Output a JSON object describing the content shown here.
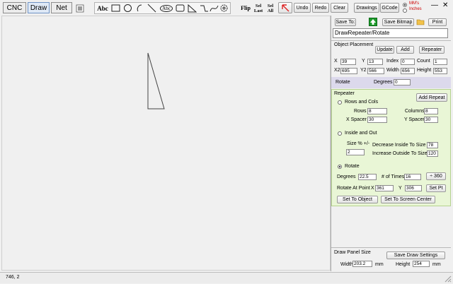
{
  "tabs": [
    {
      "label": "CNC"
    },
    {
      "label": "Draw"
    },
    {
      "label": "Net"
    }
  ],
  "toolbar": {
    "text_tool_label": "Abc",
    "circle_text_label": "Abc",
    "flip_label": "Flip",
    "sel_last_label": "Sel Last",
    "sel_all_label": "Sel All",
    "undo_label": "Undo",
    "redo_label": "Redo",
    "clear_label": "Clear",
    "drawings_label": "Drawings",
    "gcode_label": "GCode",
    "units": {
      "mm_label": "MM's",
      "inches_label": "Inches",
      "selected": "mm"
    }
  },
  "window_controls": {
    "minimize": "—",
    "close": "✕"
  },
  "side": {
    "save_to_label": "Save To:",
    "save_bitmap_label": "Save Bitmap",
    "print_label": "Print",
    "path_value": "DrawRepeater/Rotate",
    "object_placement": {
      "title": "Object Placement",
      "update_label": "Update",
      "add_label": "Add",
      "repeater_label": "Repeater",
      "x_label": "X",
      "x_value": "39",
      "y_label": "Y",
      "y_value": "13",
      "index_label": "Index",
      "index_value": "0",
      "count_label": "Count",
      "count_value": "1",
      "x2_label": "X2",
      "x2_value": "695",
      "y2_label": "Y2",
      "y2_value": "566",
      "width_label": "Width",
      "width_value": "656",
      "height_label": "Height",
      "height_value": "553"
    },
    "rotate": {
      "title": "Rotate",
      "degrees_label": "Degrees",
      "degrees_value": "0"
    },
    "repeater": {
      "title": "Repeater",
      "add_repeat_label": "Add Repeat",
      "rows_cols_label": "Rows and Cols",
      "rows_label": "Rows",
      "rows_value": "8",
      "columns_label": "Columns",
      "columns_value": "8",
      "xspacer_label": "X Spacer",
      "xspacer_value": "30",
      "yspacer_label": "Y Spacer",
      "yspacer_value": "30",
      "inside_out_label": "Inside and Out",
      "size_pct_label": "Size % +/-",
      "size_pct_value": "2",
      "decrease_label": "Decrease Inside To Size %",
      "decrease_value": "78",
      "increase_label": "Increase Outside To Size %",
      "increase_value": "120",
      "rotate_label": "Rotate",
      "selected_mode": "rotate",
      "degrees_label": "Degrees",
      "degrees_value": "22.5",
      "times_label": "# of Times",
      "times_value": "16",
      "plus360_label": "÷ 360",
      "rotate_at_point_label": "Rotate At Point",
      "rx_label": "X",
      "rx_value": "361",
      "ry_label": "Y",
      "ry_value": "306",
      "set_pt_label": "Set Pt",
      "set_to_object_label": "Set To Object",
      "set_to_center_label": "Set To Screen Center"
    },
    "draw_panel": {
      "title": "Draw Panel Size",
      "save_settings_label": "Save Draw Settings",
      "width_label": "Width",
      "width_value": "203.2",
      "height_label": "Height",
      "height_value": "254",
      "unit_label": "mm"
    }
  },
  "status": {
    "coords": "746, 2"
  }
}
